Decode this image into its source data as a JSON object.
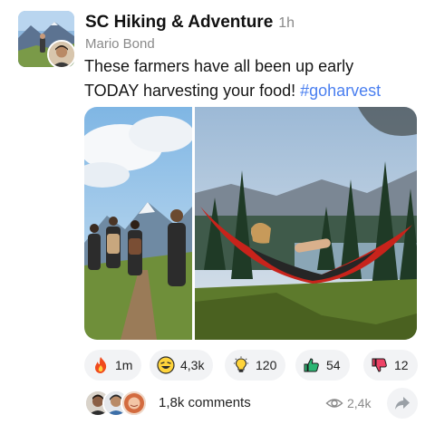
{
  "post": {
    "group_name": "SC Hiking & Adventure",
    "time": "1h",
    "author": "Mario Bond",
    "text_line1": "These farmers have all been up early",
    "text_line2": "TODAY harvesting your food! ",
    "hashtag": "#goharvest"
  },
  "media": {
    "images": [
      {
        "name": "hikers-on-mountain-trail"
      },
      {
        "name": "person-in-red-hammock-by-lake"
      }
    ]
  },
  "reactions": [
    {
      "icon": "fire-icon",
      "count": "1m"
    },
    {
      "icon": "laughing-face-icon",
      "count": "4,3k"
    },
    {
      "icon": "lightbulb-icon",
      "count": "120"
    },
    {
      "icon": "thumbs-up-icon",
      "count": "54"
    },
    {
      "icon": "thumbs-down-icon",
      "count": "12"
    }
  ],
  "footer": {
    "comments": "1,8k comments",
    "views": "2,4k",
    "share_icon": "share-arrow-icon"
  },
  "colors": {
    "hashtag": "#4a7ff0",
    "chip_background": "#f2f3f5",
    "muted_text": "#8a8a8a"
  }
}
